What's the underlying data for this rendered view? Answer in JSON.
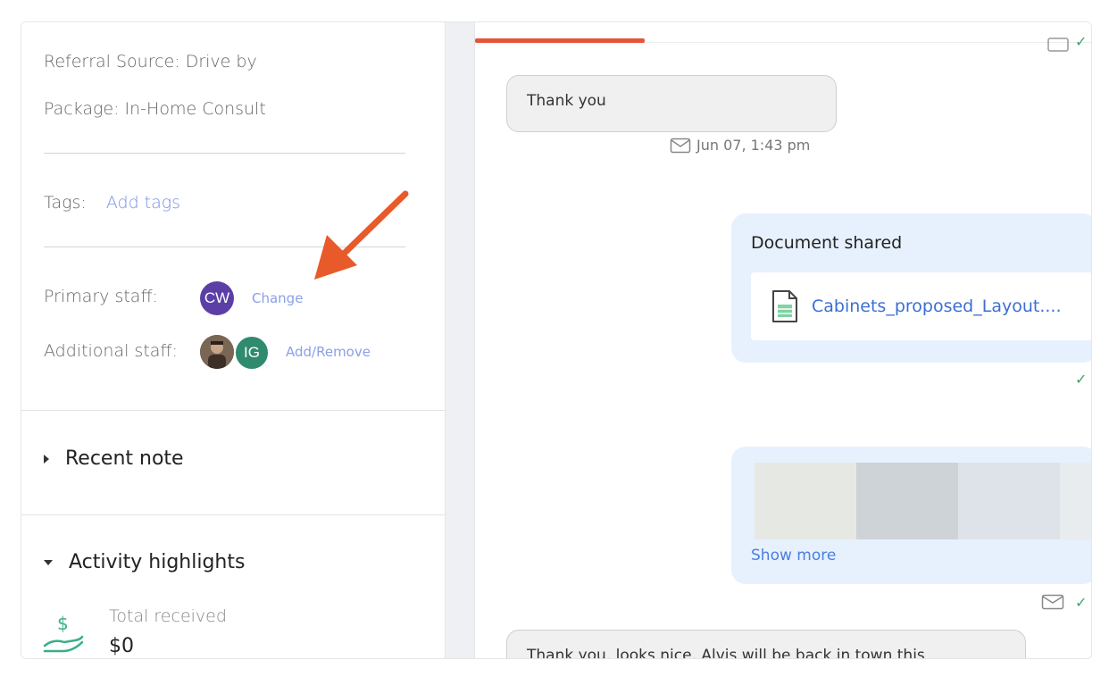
{
  "details": {
    "referral_source": "Referral Source: Drive by",
    "package": "Package: In-Home Consult",
    "tags_label": "Tags:",
    "add_tags": "Add tags",
    "primary_staff_label": "Primary staff:",
    "primary_staff_initials": "CW",
    "change_label": "Change",
    "additional_staff_label": "Additional staff:",
    "additional_staff_initials": "IG",
    "add_remove_label": "Add/Remove"
  },
  "sections": {
    "recent_note": "Recent note",
    "activity_highlights": "Activity highlights",
    "total_received_label": "Total received",
    "total_received_value": "$0"
  },
  "chat": {
    "msg1_text": "Thank you",
    "msg1_time": "Jun 07, 1:43 pm",
    "doc_title": "Document shared",
    "doc_name": "Cabinets_proposed_Layout....",
    "show_more": "Show more",
    "last_msg_text": "Thank you, looks nice. Alvis will be back in town this"
  },
  "colors": {
    "accent_link": "#7a8fe8",
    "avatar_cw": "#5b3fa6",
    "avatar_ig": "#2f8a6e",
    "arrow": "#e85a2a",
    "progress": "#e4553b"
  }
}
